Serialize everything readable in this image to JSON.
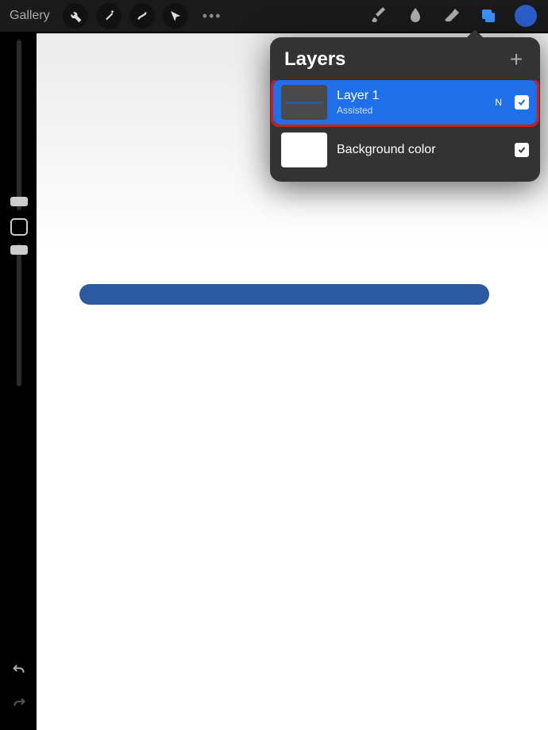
{
  "topbar": {
    "gallery_label": "Gallery",
    "layers_icon_active_color": "#3a8fff"
  },
  "color_swatch": "#2b5dc9",
  "layers_panel": {
    "title": "Layers",
    "rows": [
      {
        "name": "Layer 1",
        "subtitle": "Assisted",
        "blend": "N",
        "visible": true,
        "selected": true
      },
      {
        "name": "Background color",
        "visible": true,
        "selected": false
      }
    ]
  }
}
